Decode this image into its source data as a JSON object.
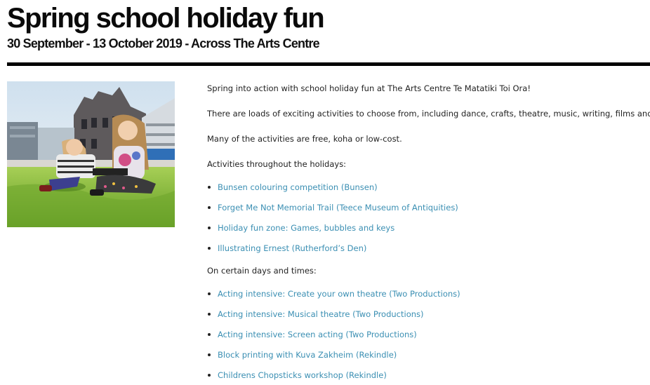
{
  "header": {
    "title": "Spring school holiday fun",
    "subtitle": "30 September - 13 October 2019 - Across The Arts Centre"
  },
  "hero_image": {
    "alt": "Two girls reading on the grass"
  },
  "intro": {
    "p1": "Spring into action with school holiday fun at The Arts Centre Te Matatiki Toi Ora!",
    "p2": "There are loads of exciting activities to choose from, including dance, crafts, theatre, music, writing, films and more.",
    "p3": "Many of the activities are free, koha or low-cost."
  },
  "holidays": {
    "heading": "Activities throughout the holidays:",
    "items": [
      "Bunsen colouring competition (Bunsen)",
      "Forget Me Not Memorial Trail (Teece Museum of Antiquities)",
      "Holiday fun zone: Games, bubbles and keys",
      "Illustrating Ernest (Rutherford’s Den)"
    ]
  },
  "certain_days": {
    "heading": "On certain days and times:",
    "items": [
      "Acting intensive: Create your own theatre (Two Productions)",
      "Acting intensive: Musical theatre (Two Productions)",
      "Acting intensive: Screen acting (Two Productions)",
      "Block printing with Kuva Zakheim (Rekindle)",
      "Childrens Chopsticks workshop (Rekindle)"
    ]
  },
  "colors": {
    "link": "#3b8fb3",
    "text": "#222222",
    "rule": "#000000"
  }
}
